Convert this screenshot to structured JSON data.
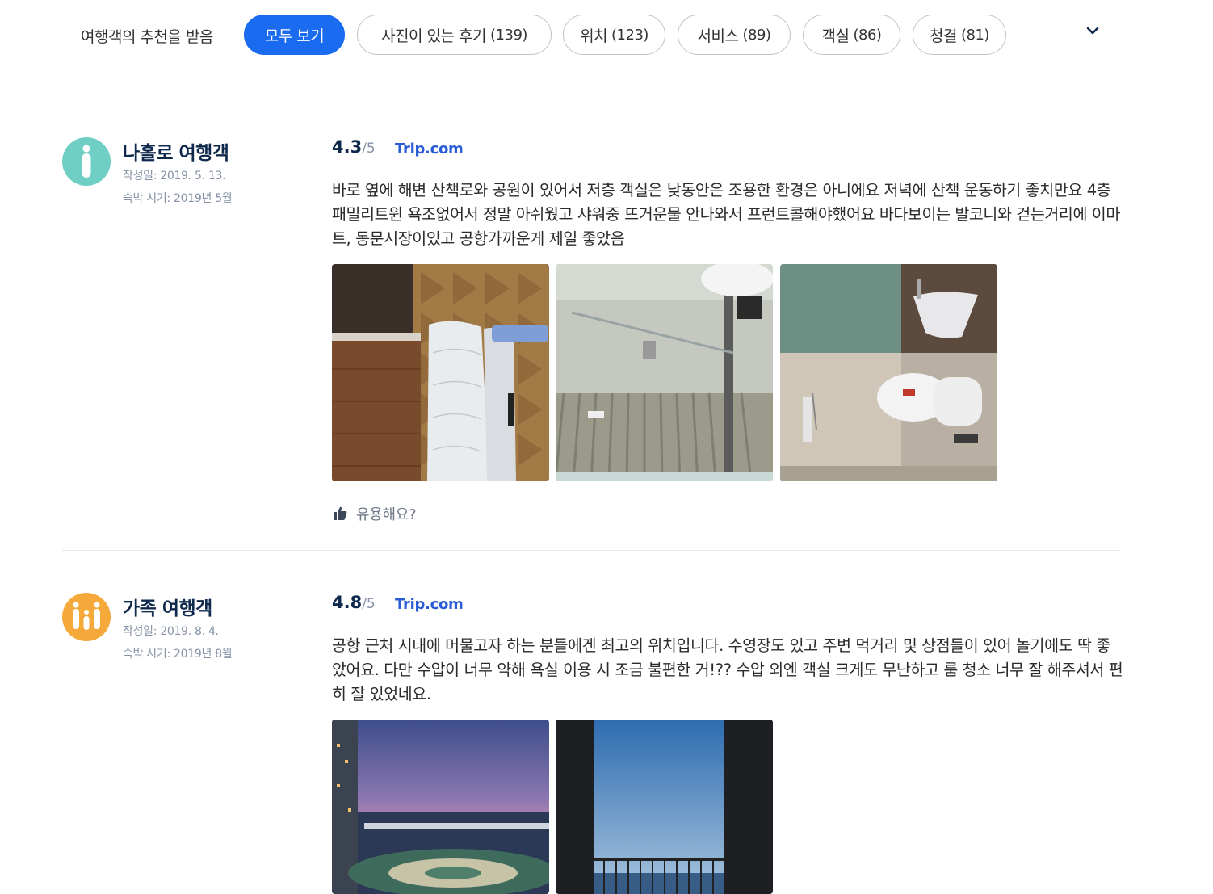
{
  "filters": {
    "label": "여행객의 추천을 받음",
    "chips": [
      {
        "label": "모두 보기",
        "count": ""
      },
      {
        "label": "사진이 있는 후기",
        "count": "(139)"
      },
      {
        "label": "위치",
        "count": "(123)"
      },
      {
        "label": "서비스",
        "count": "(89)"
      },
      {
        "label": "객실",
        "count": "(86)"
      },
      {
        "label": "청결",
        "count": "(81)"
      }
    ],
    "more_icon": "chevron-down-icon"
  },
  "reviews": [
    {
      "traveler_type": "나홀로 여행객",
      "avatar_icon": "solo-traveler-icon",
      "avatar_color": "#6fcfc4",
      "written": "작성일: 2019. 5. 13.",
      "stay": "숙박 시기: 2019년 5월",
      "score": "4.3",
      "score_max": "/5",
      "source_main": "Trip",
      "source_dot": ".",
      "source_tld": "com",
      "text": "바로 옆에 해변 산책로와 공원이 있어서 저층 객실은 낮동안은 조용한 환경은 아니에요 저녁에 산책 운동하기 좋치만요 4층 패밀리트윈 욕조없어서 정말 아쉬웠고 샤워중 뜨거운물 안나와서 프런트콜해야했어요 바다보이는 발코니와 걷는거리에 이마트, 동문시장이있고 공항가까운게 제일 좋았음",
      "helpful_label": "유용해요?"
    },
    {
      "traveler_type": "가족 여행객",
      "avatar_icon": "family-traveler-icon",
      "avatar_color": "#f5a93b",
      "written": "작성일: 2019. 8. 4.",
      "stay": "숙박 시기: 2019년 8월",
      "score": "4.8",
      "score_max": "/5",
      "source_main": "Trip",
      "source_dot": ".",
      "source_tld": "com",
      "text": "공항 근처 시내에 머물고자 하는 분들에겐 최고의 위치입니다. 수영장도 있고 주변 먹거리 및 상점들이 있어 놀기에도 딱 좋았어요. 다만 수압이 너무 약해 욕실 이용 시 조금 불편한 거!?? 수압 외엔 객실 크게도 무난하고 룸 청소 너무 잘 해주셔서 편히 잘 있었네요."
    }
  ],
  "colors": {
    "accent": "#1a6bef",
    "brand_trip": "#2a5cd7",
    "text_dark": "#0f294d",
    "text_muted": "#8592a6"
  }
}
